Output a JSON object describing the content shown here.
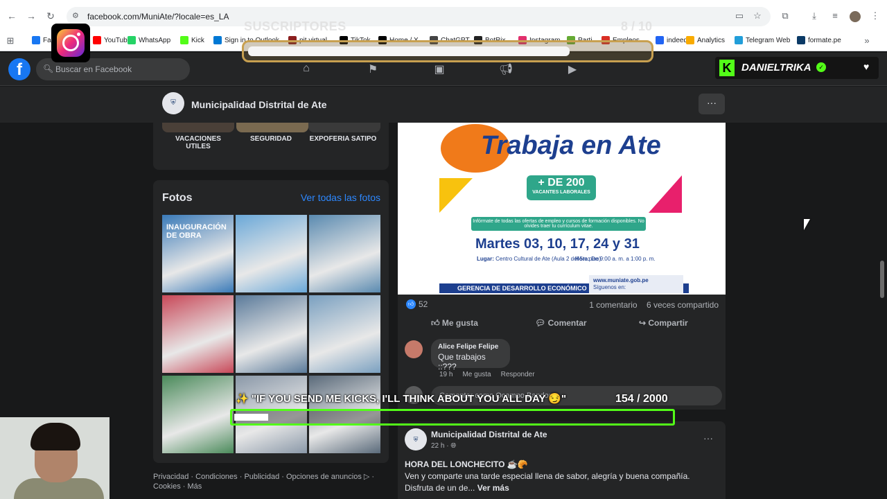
{
  "browser": {
    "url": "facebook.com/MuniAte/?locale=es_LA",
    "bookmarks": [
      {
        "label": "Fa",
        "color": "#1877f2"
      },
      {
        "label": "YouTube",
        "color": "#ff0000"
      },
      {
        "label": "WhatsApp",
        "color": "#25d366"
      },
      {
        "label": "Kick",
        "color": "#53fc18"
      },
      {
        "label": "Sign in to Outlook",
        "color": "#0078d4"
      },
      {
        "label": "pit virtual",
        "color": "#8b1e1e"
      },
      {
        "label": "TikTok",
        "color": "#000000"
      },
      {
        "label": "Home / X",
        "color": "#000000"
      },
      {
        "label": "ChatGPT",
        "color": "#444444"
      },
      {
        "label": "BotRix",
        "color": "#222222"
      },
      {
        "label": "Instagram",
        "color": "#e1306c"
      },
      {
        "label": "Parti",
        "color": "#66aa33"
      },
      {
        "label": "Empleos",
        "color": "#d93025"
      },
      {
        "label": "indeed",
        "color": "#2164f3"
      },
      {
        "label": "Analytics",
        "color": "#f9ab00"
      },
      {
        "label": "Telegram Web",
        "color": "#229ed9"
      },
      {
        "label": "formate.pe",
        "color": "#0b3a66"
      }
    ]
  },
  "header": {
    "search_placeholder": "Buscar en Facebook"
  },
  "page": {
    "name": "Municipalidad Distrital de Ate",
    "more": "···"
  },
  "highlights": [
    {
      "label": "VACACIONES UTILES"
    },
    {
      "label": "SEGURIDAD"
    },
    {
      "label": "EXPOFERIA SATIPO"
    }
  ],
  "photos": {
    "title": "Fotos",
    "see_all": "Ver todas las fotos",
    "first_photo_caption": "INAUGURACIÓN DE OBRA",
    "colors": [
      "#3a7ab8",
      "#6aa8d8",
      "#5a8ab0",
      "#c84858",
      "#5a7a9a",
      "#7aa0c0",
      "#4a8a5a",
      "#8a98a8",
      "#5a6a7a"
    ]
  },
  "post": {
    "image": {
      "title": "Trabaja en Ate",
      "badge_top": "+ DE 200",
      "badge_bottom": "VACANTES LABORALES",
      "info": "Infórmate de todas las ofertas de empleo y cursos de formación disponibles. No olvides traer tu currículum vitae.",
      "dates": "Martes 03, 10, 17, 24 y 31",
      "lugar_label": "Lugar:",
      "lugar": "Centro Cultural de Ate (Aula 2 del 5to piso)",
      "hora_label": "Hora:",
      "hora": "De 9:00 a. m. a 1:00 p. m.",
      "gerencia": "GERENCIA DE DESARROLLO ECONÓMICO",
      "web": "www.muniate.gob.pe",
      "siguenos": "Síguenos en:"
    },
    "likes": "52",
    "comments_count": "1 comentario",
    "shares": "6 veces compartido",
    "actions": {
      "like": "Me gusta",
      "comment": "Comentar",
      "share": "Compartir"
    },
    "comment": {
      "author": "Alice Felipe Felipe",
      "text": "Que trabajos ::???",
      "time": "19 h",
      "like": "Me gusta",
      "reply": "Responder"
    },
    "write_placeholder": "Comentar como Ocampo Bandon"
  },
  "post2": {
    "name": "Municipalidad Distrital de Ate",
    "time": "22 h ·",
    "headline": "HORA DEL LONCHECITO ☕🥐",
    "body": "Ven y comparte una tarde especial llena de sabor, alegría y buena compañía. Disfruta de un de...",
    "more": "Ver más"
  },
  "footer": {
    "links": "Privacidad · Condiciones · Publicidad · Opciones de anuncios ▷ · Cookies · Más"
  },
  "overlay": {
    "subs_label": "SUSCRIPTORES",
    "subs_count": "8 / 10",
    "subs_progress": 0.8,
    "kick_name": "DANIELTRIKA",
    "goal_text": "✨ \"IF YOU SEND ME KICKS, I'LL THINK ABOUT YOU ALL DAY 😏\"",
    "goal_count": "154  / 2000",
    "goal_progress": 0.077
  }
}
